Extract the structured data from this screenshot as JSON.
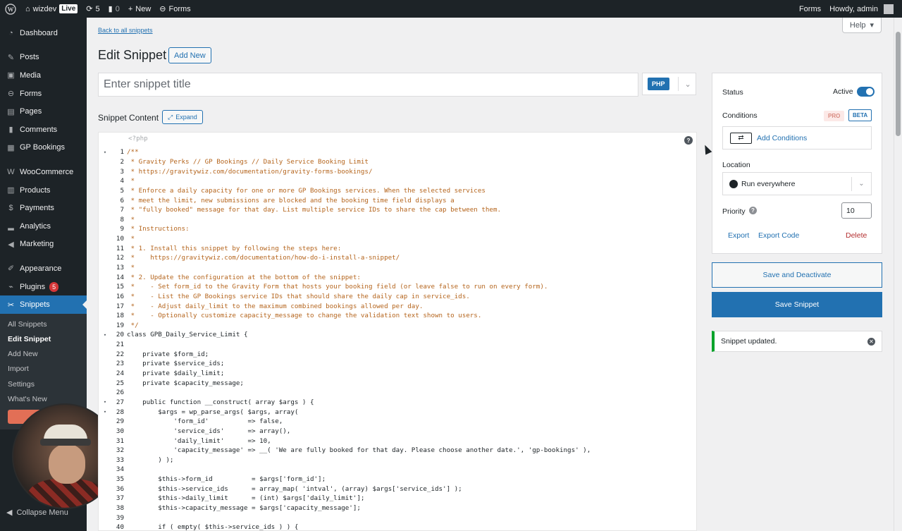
{
  "adminbar": {
    "site_name": "wizdev",
    "live_badge": "Live",
    "updates_count": "5",
    "comments_count": "0",
    "new_label": "New",
    "forms_label": "Forms",
    "right_forms": "Forms",
    "howdy": "Howdy, admin"
  },
  "sidebar": {
    "items": [
      {
        "label": "Dashboard",
        "icon": "dashboard-icon"
      },
      {
        "label": "Posts",
        "icon": "pin-icon"
      },
      {
        "label": "Media",
        "icon": "media-icon"
      },
      {
        "label": "Forms",
        "icon": "forms-icon"
      },
      {
        "label": "Pages",
        "icon": "pages-icon"
      },
      {
        "label": "Comments",
        "icon": "comments-icon"
      },
      {
        "label": "GP Bookings",
        "icon": "calendar-icon"
      },
      {
        "label": "WooCommerce",
        "icon": "woocommerce-icon"
      },
      {
        "label": "Products",
        "icon": "products-icon"
      },
      {
        "label": "Payments",
        "icon": "payments-icon"
      },
      {
        "label": "Analytics",
        "icon": "analytics-icon"
      },
      {
        "label": "Marketing",
        "icon": "marketing-icon"
      },
      {
        "label": "Appearance",
        "icon": "appearance-icon"
      },
      {
        "label": "Plugins",
        "icon": "plugins-icon",
        "badge": "5"
      },
      {
        "label": "Snippets",
        "icon": "scissors-icon"
      }
    ],
    "submenu": [
      "All Snippets",
      "Edit Snippet",
      "Add New",
      "Import",
      "Settings",
      "What's New"
    ],
    "collapse_label": "Collapse Menu"
  },
  "main": {
    "back_link": "Back to all snippets",
    "help_label": "Help",
    "page_title": "Edit Snippet",
    "add_new": "Add New",
    "title_placeholder": "Enter snippet title",
    "lang": "PHP",
    "content_label": "Snippet Content",
    "expand_label": "Expand",
    "php_open": "<?php"
  },
  "code": {
    "lines": [
      {
        "n": "1",
        "fold": true,
        "cm": true,
        "t": "/**"
      },
      {
        "n": "2",
        "cm": true,
        "t": " * Gravity Perks // GP Bookings // Daily Service Booking Limit"
      },
      {
        "n": "3",
        "cm": true,
        "t": " * https://gravitywiz.com/documentation/gravity-forms-bookings/"
      },
      {
        "n": "4",
        "cm": true,
        "t": " *"
      },
      {
        "n": "5",
        "cm": true,
        "t": " * Enforce a daily capacity for one or more GP Bookings services. When the selected services"
      },
      {
        "n": "6",
        "cm": true,
        "t": " * meet the limit, new submissions are blocked and the booking time field displays a"
      },
      {
        "n": "7",
        "cm": true,
        "t": " * \"fully booked\" message for that day. List multiple service IDs to share the cap between them."
      },
      {
        "n": "8",
        "cm": true,
        "t": " *"
      },
      {
        "n": "9",
        "cm": true,
        "t": " * Instructions:"
      },
      {
        "n": "10",
        "cm": true,
        "t": " *"
      },
      {
        "n": "11",
        "cm": true,
        "t": " * 1. Install this snippet by following the steps here:"
      },
      {
        "n": "12",
        "cm": true,
        "t": " *    https://gravitywiz.com/documentation/how-do-i-install-a-snippet/"
      },
      {
        "n": "13",
        "cm": true,
        "t": " *"
      },
      {
        "n": "14",
        "cm": true,
        "t": " * 2. Update the configuration at the bottom of the snippet:"
      },
      {
        "n": "15",
        "cm": true,
        "t": " *    - Set form_id to the Gravity Form that hosts your booking field (or leave false to run on every form)."
      },
      {
        "n": "16",
        "cm": true,
        "t": " *    - List the GP Bookings service IDs that should share the daily cap in service_ids."
      },
      {
        "n": "17",
        "cm": true,
        "t": " *    - Adjust daily_limit to the maximum combined bookings allowed per day."
      },
      {
        "n": "18",
        "cm": true,
        "t": " *    - Optionally customize capacity_message to change the validation text shown to users."
      },
      {
        "n": "19",
        "cm": true,
        "t": " */"
      },
      {
        "n": "20",
        "fold": true,
        "t": "class GPB_Daily_Service_Limit {"
      },
      {
        "n": "21",
        "t": ""
      },
      {
        "n": "22",
        "t": "    private $form_id;"
      },
      {
        "n": "23",
        "t": "    private $service_ids;"
      },
      {
        "n": "24",
        "t": "    private $daily_limit;"
      },
      {
        "n": "25",
        "t": "    private $capacity_message;"
      },
      {
        "n": "26",
        "t": ""
      },
      {
        "n": "27",
        "fold": true,
        "t": "    public function __construct( array $args ) {"
      },
      {
        "n": "28",
        "fold": true,
        "t": "        $args = wp_parse_args( $args, array("
      },
      {
        "n": "29",
        "t": "            'form_id'          => false,"
      },
      {
        "n": "30",
        "t": "            'service_ids'      => array(),"
      },
      {
        "n": "31",
        "t": "            'daily_limit'      => 10,"
      },
      {
        "n": "32",
        "t": "            'capacity_message' => __( 'We are fully booked for that day. Please choose another date.', 'gp-bookings' ),"
      },
      {
        "n": "33",
        "t": "        ) );"
      },
      {
        "n": "34",
        "t": ""
      },
      {
        "n": "35",
        "t": "        $this->form_id          = $args['form_id'];"
      },
      {
        "n": "36",
        "t": "        $this->service_ids      = array_map( 'intval', (array) $args['service_ids'] );"
      },
      {
        "n": "37",
        "t": "        $this->daily_limit      = (int) $args['daily_limit'];"
      },
      {
        "n": "38",
        "t": "        $this->capacity_message = $args['capacity_message'];"
      },
      {
        "n": "39",
        "t": ""
      },
      {
        "n": "40",
        "t": "        if ( empty( $this->service_ids ) ) {"
      }
    ]
  },
  "panel": {
    "status_label": "Status",
    "status_value": "Active",
    "conditions_label": "Conditions",
    "pro_badge": "PRO",
    "beta_badge": "BETA",
    "add_conditions": "Add Conditions",
    "location_label": "Location",
    "location_value": "Run everywhere",
    "priority_label": "Priority",
    "priority_value": "10",
    "export": "Export",
    "export_code": "Export Code",
    "delete": "Delete",
    "save_deactivate": "Save and Deactivate",
    "save_snippet": "Save Snippet",
    "notice": "Snippet updated."
  }
}
